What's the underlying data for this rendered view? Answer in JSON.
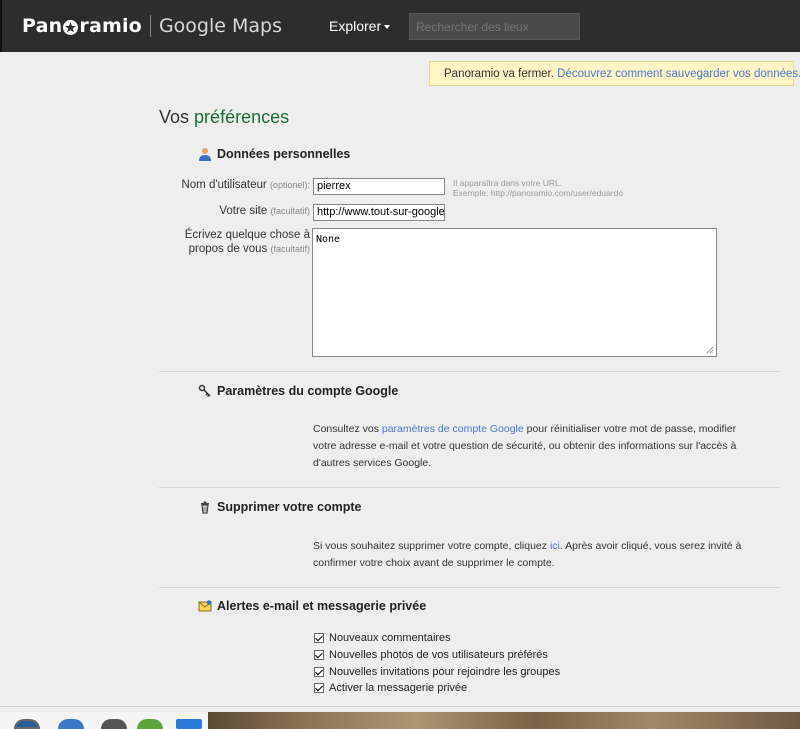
{
  "header": {
    "logo_text_before": "Pan",
    "logo_text_after": "ramio",
    "logo_product": "Google Maps",
    "explorer_label": "Explorer",
    "search_placeholder": "Rechercher des lieux"
  },
  "notice": {
    "text": "Panoramio va fermer.",
    "link": "Découvrez comment sauvegarder vos données."
  },
  "page": {
    "title_prefix": "Vos",
    "title_highlight": "préférences"
  },
  "personal": {
    "heading": "Données personnelles",
    "username_label": "Nom d'utilisateur",
    "username_opt": "(optionel):",
    "username_value": "pierrex",
    "hint_line1": "Il apparaîtra dans votre URL.",
    "hint_line2": "Exemple: http://panoramio.com/user/eduardo",
    "site_label": "Votre site",
    "site_opt": "(facultatif)",
    "site_value": "http://www.tout-sur-google",
    "about_label_1": "Écrivez quelque chose à",
    "about_label_2": "propos de vous",
    "about_opt": "(facultatif)",
    "about_value": "None"
  },
  "google_account": {
    "heading": "Paramètres du compte Google",
    "text_before": "Consultez vos",
    "link": "paramètres de compte Google",
    "text_after": "pour réinitialiser votre mot de passe, modifier votre adresse e-mail et votre question de sécurité, ou obtenir des informations sur l'accès à d'autres services Google."
  },
  "delete_account": {
    "heading": "Supprimer votre compte",
    "text_before": "Si vous souhaitez supprimer votre compte, cliquez",
    "link": "ici",
    "text_after": ". Après avoir cliqué, vous serez invité à confirmer votre choix avant de supprimer le compte."
  },
  "alerts": {
    "heading": "Alertes e-mail et messagerie privée",
    "options": [
      {
        "label": "Nouveaux commentaires",
        "checked": true
      },
      {
        "label": "Nouvelles photos de vos utilisateurs préférés",
        "checked": true
      },
      {
        "label": "Nouvelles invitations pour rejoindre les groupes",
        "checked": true
      },
      {
        "label": "Activer la messagerie privée",
        "checked": true
      }
    ]
  }
}
